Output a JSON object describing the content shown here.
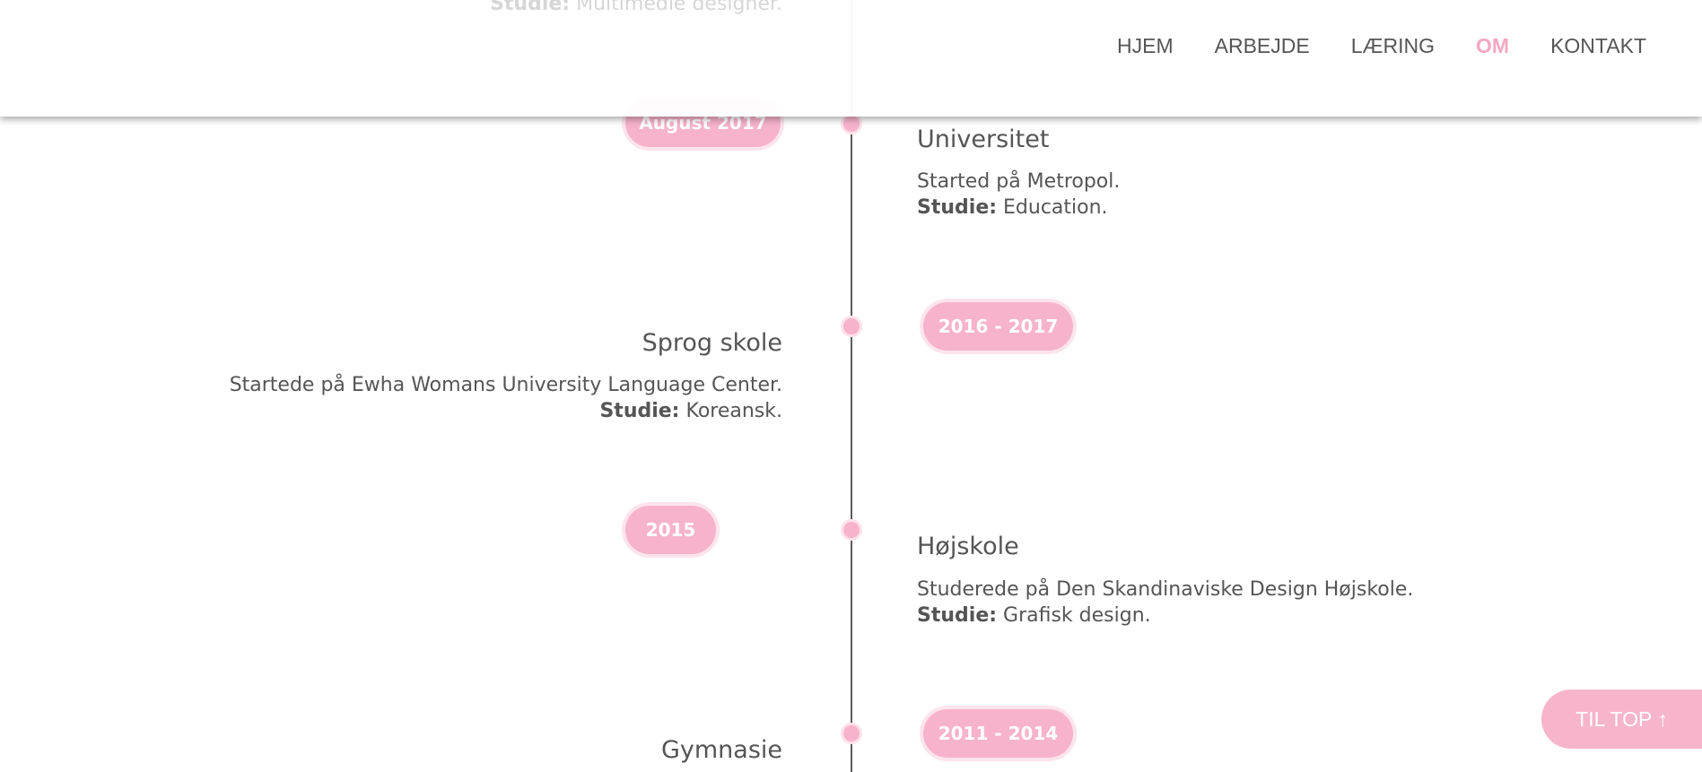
{
  "nav": {
    "items": [
      {
        "label": "HJEM"
      },
      {
        "label": "ARBEJDE"
      },
      {
        "label": "LÆRING"
      },
      {
        "label": "OM",
        "active": true
      },
      {
        "label": "KONTAKT"
      }
    ]
  },
  "faded_top": {
    "studie_label": "Studie:",
    "studie_value": "Multimedie designer."
  },
  "timeline": [
    {
      "date": "August 2017",
      "title": "Universitet",
      "line1": "Started på Metropol.",
      "studie_label": "Studie:",
      "studie_value": "Education."
    },
    {
      "date": "2016 - 2017",
      "title": "Sprog skole",
      "line1": "Startede på Ewha Womans University Language Center.",
      "studie_label": "Studie:",
      "studie_value": "Koreansk."
    },
    {
      "date": "2015",
      "title": "Højskole",
      "line1": "Studerede på Den Skandinaviske Design Højskole.",
      "studie_label": "Studie:",
      "studie_value": "Grafisk design."
    },
    {
      "date": "2011 - 2014",
      "title": "Gymnasie"
    }
  ],
  "to_top": {
    "label": "TIL TOP ↑"
  },
  "colors": {
    "accent": "#f7b3cc",
    "text": "#555555",
    "line": "#5c5c5c"
  }
}
